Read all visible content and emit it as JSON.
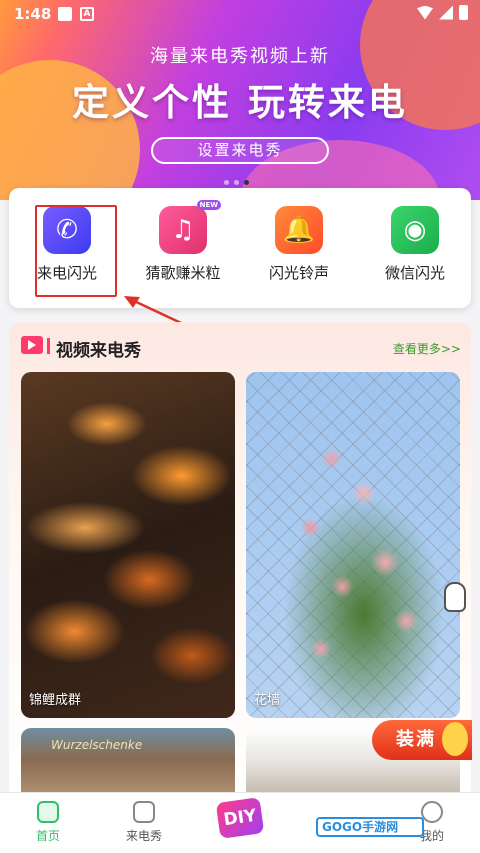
{
  "status_bar": {
    "time": "1:48"
  },
  "banner": {
    "subtitle": "海量来电秀视频上新",
    "title": "定义个性 玩转来电",
    "button": "设置来电秀"
  },
  "quick_actions": [
    {
      "label": "来电闪光",
      "icon": "phone-flash-icon",
      "color": "#5b48f5"
    },
    {
      "label": "猜歌赚米粒",
      "icon": "music-note-icon",
      "color": "#f0407a",
      "tag": "NEW"
    },
    {
      "label": "闪光铃声",
      "icon": "bell-icon",
      "color": "#ff5a2e"
    },
    {
      "label": "微信闪光",
      "icon": "wechat-icon",
      "color": "#25c05a"
    }
  ],
  "video_section": {
    "title": "视频来电秀",
    "more": "查看更多>>"
  },
  "videos": [
    {
      "caption": "锦鲤成群"
    },
    {
      "caption": "花墙"
    },
    {
      "caption": "Wurzelschenke"
    }
  ],
  "promo_badge": "装满",
  "watermark": "GOGO手游网",
  "nav": {
    "home": "首页",
    "ringshow": "来电秀",
    "diy": "DIY",
    "mine": "我的"
  }
}
